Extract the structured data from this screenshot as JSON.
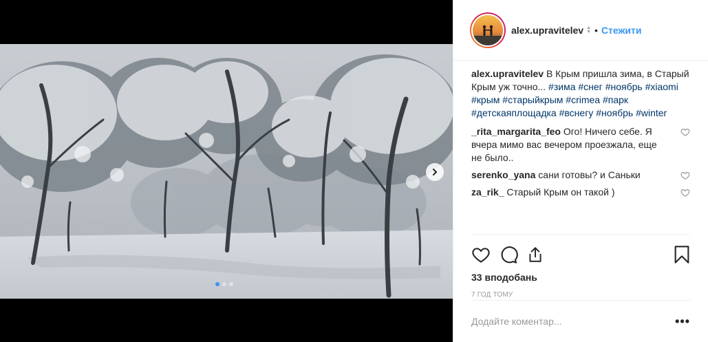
{
  "post": {
    "username": "alex.upravitelev",
    "follow_label": "Стежити",
    "bullet": "•",
    "caption": {
      "username": "alex.upravitelev",
      "text": "В Крым пришла зима, в Старый Крым уж точно...",
      "hashtags": [
        "#зима",
        "#снег",
        "#ноябрь",
        "#xiaomi",
        "#крым",
        "#старыйкрым",
        "#crimea",
        "#парк",
        "#детскаяплощадка",
        "#вснегу",
        "#ноябрь",
        "#winter"
      ]
    },
    "comments": [
      {
        "username": "_rita_margarita_feo",
        "text": "Ого! Ничего себе. Я вчера мимо вас вечером проезжала, еще не было.."
      },
      {
        "username": "serenko_yana",
        "text": "сани готовы? и Саньки"
      },
      {
        "username": "za_rik_",
        "text": "Старый Крым он такой )"
      }
    ],
    "likes": "33 вподобань",
    "time": "7 год тому",
    "add_comment_placeholder": "Додайте коментар...",
    "more_label": "•••",
    "carousel": {
      "slides": 3,
      "active": 1
    }
  },
  "icons": {
    "heart": "heart-icon",
    "comment": "comment-icon",
    "share": "share-icon",
    "save": "bookmark-icon",
    "next": "chevron-right-icon"
  },
  "colors": {
    "accent": "#3897f0",
    "hashtag": "#003569",
    "muted": "#999999"
  }
}
